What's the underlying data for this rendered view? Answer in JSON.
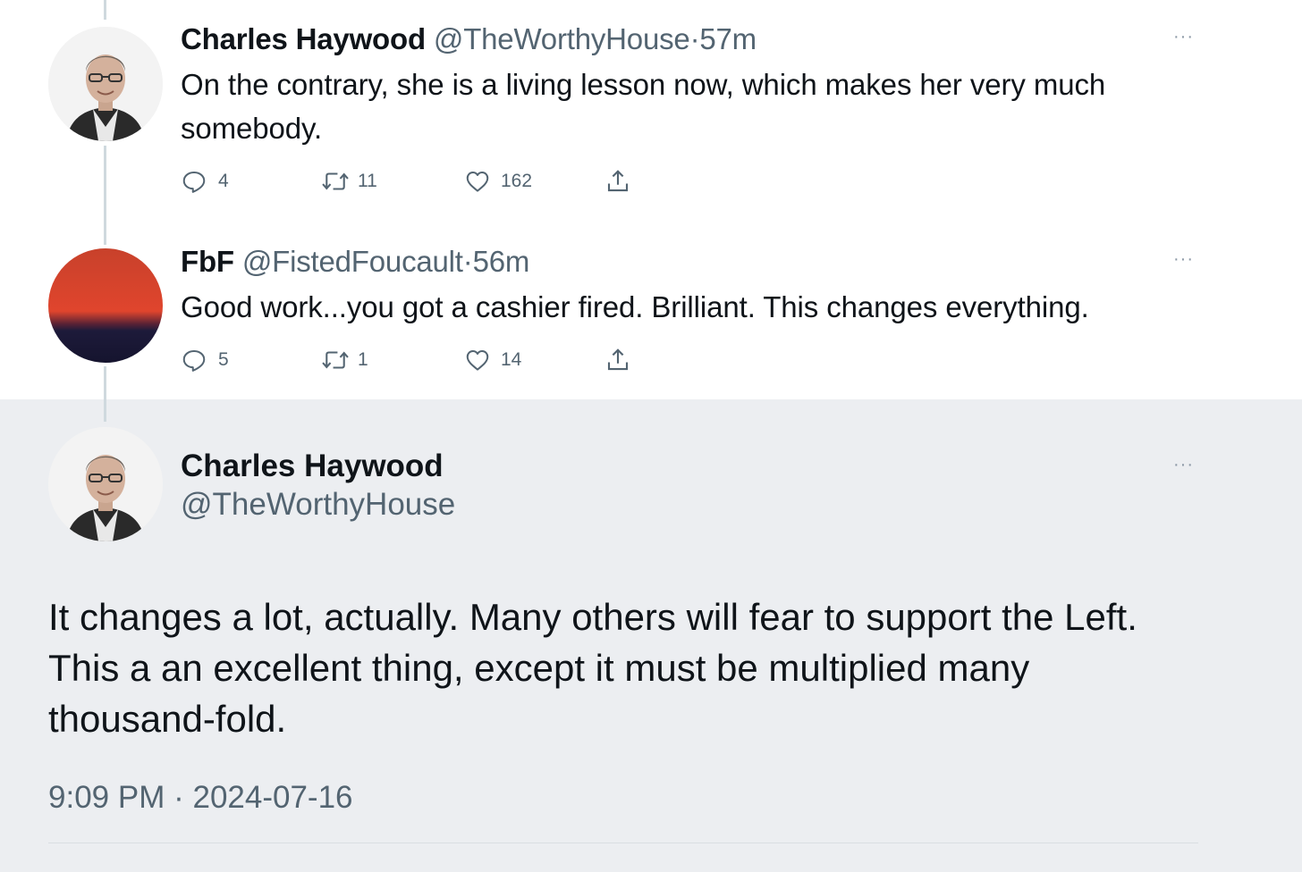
{
  "replies": [
    {
      "name": "Charles Haywood",
      "handle": "@TheWorthyHouse",
      "separator": "·",
      "time": "57m",
      "text": "On the contrary, she is a living lesson now, which makes her very much somebody.",
      "replies": "4",
      "retweets": "11",
      "likes": "162",
      "more": "···"
    },
    {
      "name": "FbF",
      "handle": "@FistedFoucault",
      "separator": "·",
      "time": "56m",
      "text": "Good work...you got a cashier fired.  Brilliant.  This changes everything.",
      "replies": "5",
      "retweets": "1",
      "likes": "14",
      "more": "···"
    }
  ],
  "main": {
    "name": "Charles Haywood",
    "handle": "@TheWorthyHouse",
    "text": "It changes a lot, actually. Many others will fear to support the Left. This a an excellent thing, except it must be multiplied many thousand-fold.",
    "time": "9:09 PM",
    "separator": "·",
    "date": "2024-07-16",
    "more": "···"
  },
  "icons": {
    "reply": "reply-bubble-icon",
    "retweet": "retweet-arrows-icon",
    "like": "heart-icon",
    "share": "share-upload-icon"
  },
  "colors": {
    "text": "#0f1419",
    "secondary": "#536471",
    "highlight_bg": "#eceef1",
    "thread_line": "#cfd9de"
  }
}
